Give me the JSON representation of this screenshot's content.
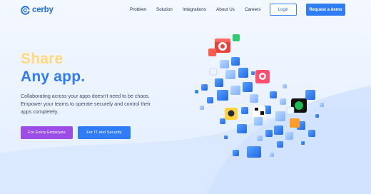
{
  "brand": {
    "name": "cerby",
    "logo_icon": "cerby-logo-icon",
    "accent": "#2f7cf6"
  },
  "nav": {
    "items": [
      {
        "label": "Problem"
      },
      {
        "label": "Solution"
      },
      {
        "label": "Integrations"
      },
      {
        "label": "About Us"
      },
      {
        "label": "Careers"
      }
    ],
    "login_label": "Login",
    "demo_label": "Request a demo"
  },
  "hero": {
    "line1": "Share",
    "line2": "Any app.",
    "description": "Collaborating across your apps doesn't need to be chaos. Empower your teams to operate securely and control their apps completely.",
    "cta_employee": "For Every Employee",
    "cta_it": "For IT and Security"
  },
  "colors": {
    "share": "#ffd97a",
    "employee_button": "#9b4de6",
    "it_button": "#2f7cf6"
  }
}
